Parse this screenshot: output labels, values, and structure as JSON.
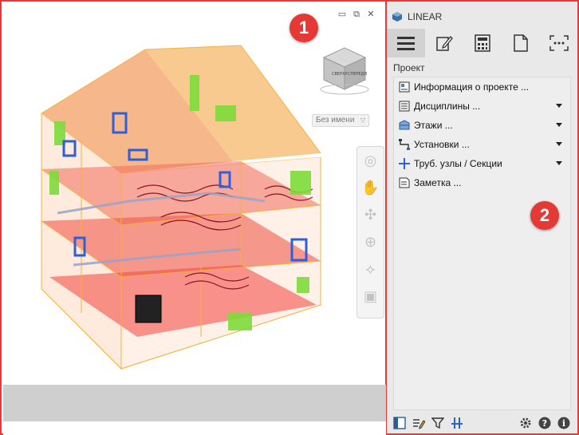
{
  "viewport": {
    "view_name": "Без имени",
    "view_name_arrow": "▽",
    "badge": "1",
    "cube_faces": {
      "top": "",
      "left": "СВЕРХУ",
      "right": "СПЕРЕДИ"
    }
  },
  "panel": {
    "app_name": "LINEAR",
    "badge": "2",
    "section_label": "Проект",
    "tabs": [
      {
        "name": "menu-icon",
        "active": true
      },
      {
        "name": "pencil-icon",
        "active": false
      },
      {
        "name": "calculator-icon",
        "active": false
      },
      {
        "name": "document-icon",
        "active": false
      },
      {
        "name": "more-icon",
        "active": false
      }
    ],
    "tree": [
      {
        "label": "Информация о проекте ...",
        "icon": "project-info-icon",
        "dropdown": false
      },
      {
        "label": "Дисциплины ...",
        "icon": "disciplines-icon",
        "dropdown": true
      },
      {
        "label": "Этажи ...",
        "icon": "floors-icon",
        "dropdown": true
      },
      {
        "label": "Установки ...",
        "icon": "installations-icon",
        "dropdown": true
      },
      {
        "label": "Труб. узлы / Секции",
        "icon": "pipe-nodes-icon",
        "dropdown": true
      },
      {
        "label": "Заметка ...",
        "icon": "note-icon",
        "dropdown": false
      }
    ],
    "footer_icons": [
      "layout-icon",
      "edit-list-icon",
      "filter-icon",
      "pipe-node-icon",
      "gear-icon",
      "help-icon",
      "info-icon"
    ]
  },
  "colors": {
    "accent_red": "#e53935",
    "frame_orange": "#f5b13a",
    "floor_red": "#f04a4a",
    "pipe_blue": "#2f5fd8",
    "radiator_green": "#7ddc3a"
  }
}
